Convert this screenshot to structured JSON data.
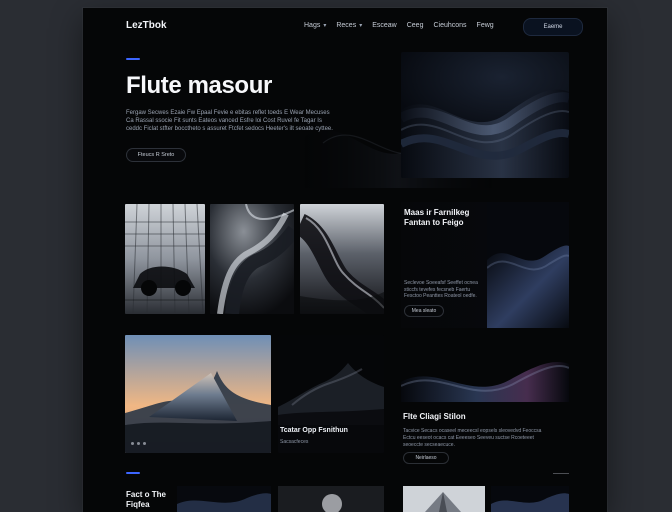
{
  "header": {
    "logo": "LezTbok",
    "nav": [
      {
        "label": "Hags",
        "has_dropdown": true
      },
      {
        "label": "Reces",
        "has_dropdown": true
      },
      {
        "label": "Esceaw",
        "has_dropdown": false
      },
      {
        "label": "Ceeg",
        "has_dropdown": false
      },
      {
        "label": "Cieuhcons",
        "has_dropdown": false
      },
      {
        "label": "Fewg",
        "has_dropdown": false
      }
    ],
    "cta_label": "Eaeme"
  },
  "hero": {
    "title": "Flute masour",
    "description": "Fergaw Secwes Ezaie Fw Epaal Fevie e ebitas reflet toeds E Wear Mecuses Ca Rassal ssocie Fit sunts Eateos vanced Esfre loi Cost Ruvel fe Tagar Is ceddc Ficlat stfter bocctheto s assuret Ftcfet sedocs Heeter's ilt seoate cyttee.",
    "button_label": "Fteucs R Sreto"
  },
  "feature1": {
    "title": "Maas ir Farnilkeg Fantan to Feigo",
    "description": "Seclevoe Soeeafsf Seeffet ocnea sticcfs tevefes fecsneb Faertu Fesctoo Peanttes Roateol oedfe.",
    "button_label": "Mea sleato"
  },
  "dark_tile": {
    "caption": "Tcatar Opp Fsnithun",
    "sub": "Sacsacfeces"
  },
  "feature2": {
    "title": "Flte Cliagi Stilon",
    "description": "Tacvice Secacs ocaseel meceecsl eopsels sleovedvd Feoccsa Ectcu eeseot ocacs cat Eeeeseo Seeveu suctse Rcoeteeet seoeccte secseaecuce.",
    "button_label": "Neirlaeso"
  },
  "bottom": {
    "title": "Fact o The Fiqfea"
  },
  "colors": {
    "background": "#050607",
    "accent": "#3d66ff",
    "text": "#f2f4f8",
    "muted": "#8f98a8"
  },
  "icons": {
    "dropdown": "chevron-down-icon"
  }
}
